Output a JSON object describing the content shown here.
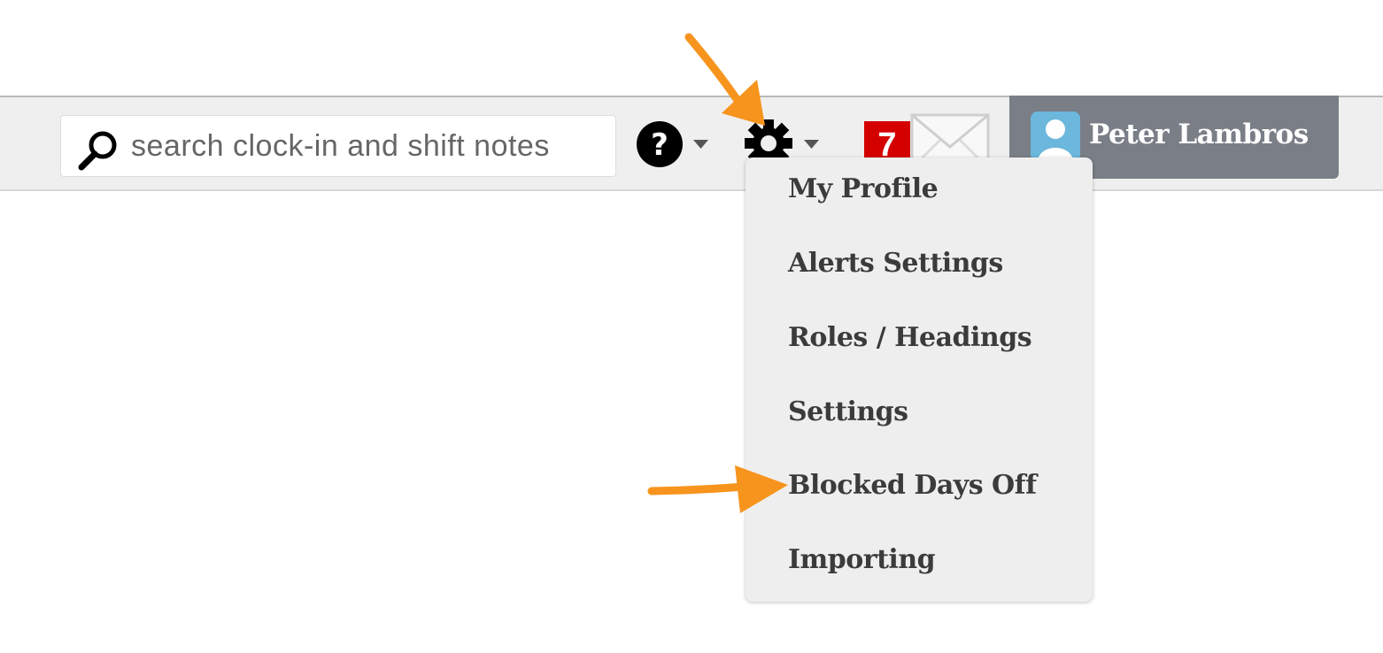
{
  "search": {
    "placeholder": "search clock-in and shift notes"
  },
  "notifications": {
    "badge_count": "7"
  },
  "user": {
    "name": "Peter Lambros"
  },
  "settings_menu": {
    "items": [
      {
        "label": "My Profile"
      },
      {
        "label": "Alerts Settings"
      },
      {
        "label": "Roles / Headings"
      },
      {
        "label": "Settings"
      },
      {
        "label": "Blocked Days Off"
      },
      {
        "label": "Importing"
      }
    ]
  },
  "colors": {
    "accent_arrow": "#f7941d",
    "badge_red": "#d40000",
    "user_box": "#7a7e87",
    "avatar_blue": "#6cb7dc"
  },
  "icons": [
    "search-icon",
    "help-icon",
    "gear-icon",
    "chevron-down-icon",
    "mail-icon",
    "avatar"
  ]
}
